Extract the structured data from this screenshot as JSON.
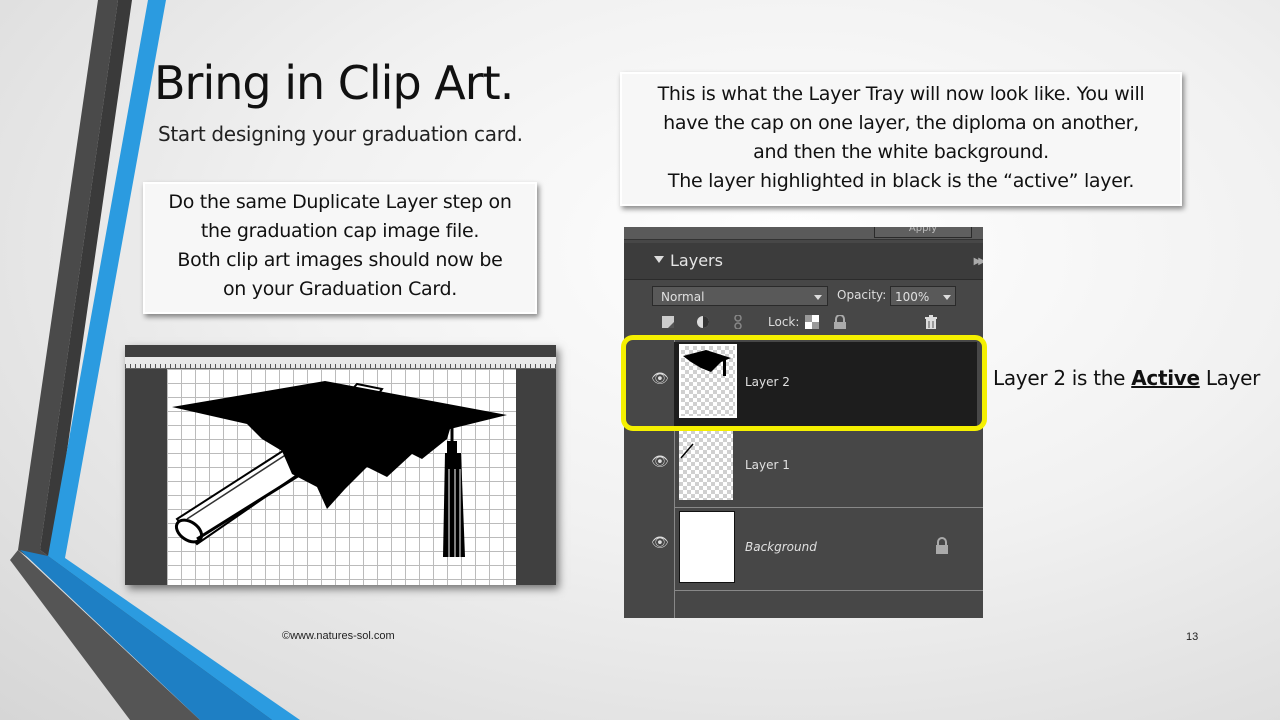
{
  "slide": {
    "title": "Bring in Clip Art.",
    "subtitle": "Start designing your graduation card.",
    "left_callout": [
      "Do the same Duplicate Layer step on",
      "the graduation cap image file.",
      "Both clip art images should now be",
      "on your Graduation Card."
    ],
    "right_callout": [
      "This is what the Layer Tray will now look like. You will",
      "have the cap on one layer, the diploma on another,",
      "and then the white background.",
      "The layer highlighted in black is the “active” layer."
    ],
    "active_note": {
      "prefix": "Layer 2 is the ",
      "bold": "Active",
      "suffix": " Layer"
    },
    "footer": "©www.natures-sol.com",
    "page_number": "13",
    "highlight_color": "#f5f000"
  },
  "layers_panel": {
    "title": "Layers",
    "apply_button": "Apply",
    "blend_mode": "Normal",
    "opacity_label": "Opacity:",
    "opacity_value": "100%",
    "lock_label": "Lock:",
    "icons": [
      "new-layer-icon",
      "adjustment-icon",
      "link-icon",
      "lock-transparency-icon",
      "lock-all-icon",
      "trash-icon"
    ],
    "layers": [
      {
        "name": "Layer 2",
        "active": true,
        "thumb": "cap"
      },
      {
        "name": "Layer 1",
        "active": false,
        "thumb": "diploma"
      },
      {
        "name": "Background",
        "active": false,
        "thumb": "white",
        "locked": true
      }
    ]
  }
}
